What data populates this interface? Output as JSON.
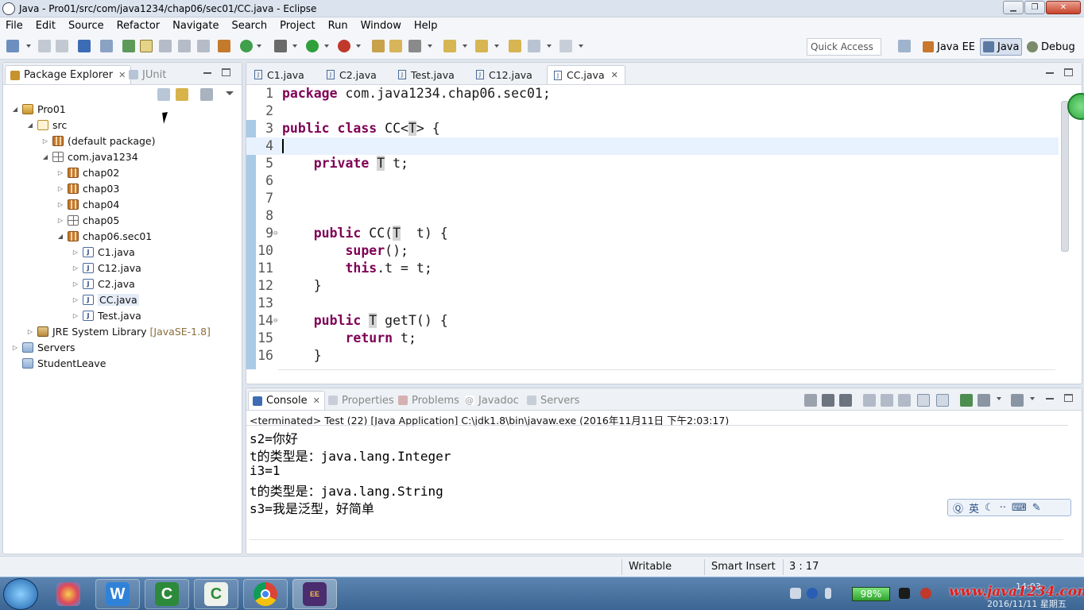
{
  "window": {
    "title": "Java - Pro01/src/com/java1234/chap06/sec01/CC.java - Eclipse"
  },
  "menu": [
    "File",
    "Edit",
    "Source",
    "Refactor",
    "Navigate",
    "Search",
    "Project",
    "Run",
    "Window",
    "Help"
  ],
  "toolbar": {
    "quick_access": "Quick Access",
    "perspectives": [
      "Java EE",
      "Java",
      "Debug"
    ]
  },
  "left_panel": {
    "tabs": [
      {
        "label": "Package Explorer",
        "active": true
      },
      {
        "label": "JUnit",
        "active": false
      }
    ],
    "tree": [
      {
        "label": "Pro01",
        "depth": 0,
        "icon": "project-icon",
        "expanded": true
      },
      {
        "label": "src",
        "depth": 1,
        "icon": "source-folder-icon",
        "expanded": true
      },
      {
        "label": "(default package)",
        "depth": 2,
        "icon": "package-icon",
        "expanded": false
      },
      {
        "label": "com.java1234",
        "depth": 2,
        "icon": "package-empty-icon",
        "expanded": true
      },
      {
        "label": "chap02",
        "depth": 3,
        "icon": "package-icon",
        "expanded": false
      },
      {
        "label": "chap03",
        "depth": 3,
        "icon": "package-icon",
        "expanded": false
      },
      {
        "label": "chap04",
        "depth": 3,
        "icon": "package-icon",
        "expanded": false
      },
      {
        "label": "chap05",
        "depth": 3,
        "icon": "package-empty-icon",
        "expanded": false
      },
      {
        "label": "chap06.sec01",
        "depth": 3,
        "icon": "package-icon",
        "expanded": true
      },
      {
        "label": "C1.java",
        "depth": 4,
        "icon": "java-file-icon",
        "expanded": false
      },
      {
        "label": "C12.java",
        "depth": 4,
        "icon": "java-file-icon",
        "expanded": false
      },
      {
        "label": "C2.java",
        "depth": 4,
        "icon": "java-file-icon",
        "expanded": false
      },
      {
        "label": "CC.java",
        "depth": 4,
        "icon": "java-file-icon",
        "expanded": false,
        "selected": true
      },
      {
        "label": "Test.java",
        "depth": 4,
        "icon": "java-file-icon",
        "expanded": false
      },
      {
        "label": "JRE System Library",
        "suffix": "[JavaSE-1.8]",
        "depth": 1,
        "icon": "library-icon",
        "expanded": false
      },
      {
        "label": "Servers",
        "depth": 0,
        "icon": "folder-icon",
        "expanded": false
      },
      {
        "label": "StudentLeave",
        "depth": 0,
        "icon": "folder-icon",
        "leaf": true
      }
    ]
  },
  "editor": {
    "tabs": [
      {
        "label": "C1.java"
      },
      {
        "label": "C2.java"
      },
      {
        "label": "Test.java"
      },
      {
        "label": "C12.java"
      },
      {
        "label": "CC.java",
        "active": true
      }
    ],
    "lines": [
      {
        "n": "1",
        "segs": [
          [
            "kw",
            "package"
          ],
          [
            "",
            "com.java1234.chap06.sec01;"
          ]
        ]
      },
      {
        "n": "2",
        "segs": []
      },
      {
        "n": "3",
        "segs": [
          [
            "kw",
            "public"
          ],
          [
            "kw",
            "class"
          ],
          [
            "",
            "CC<"
          ],
          [
            "tv",
            "T"
          ],
          [
            "",
            "> {"
          ]
        ]
      },
      {
        "n": "4",
        "segs": [],
        "current": true
      },
      {
        "n": "5",
        "segs": [
          [
            "",
            "    "
          ],
          [
            "kw",
            "private"
          ],
          [
            "tv",
            "T"
          ],
          [
            "",
            "t;"
          ]
        ]
      },
      {
        "n": "6",
        "segs": []
      },
      {
        "n": "7",
        "segs": []
      },
      {
        "n": "8",
        "segs": []
      },
      {
        "n": "9",
        "fold": true,
        "segs": [
          [
            "",
            "    "
          ],
          [
            "kw",
            "public"
          ],
          [
            "",
            "CC("
          ],
          [
            "tv",
            "T"
          ],
          [
            "",
            " t) {"
          ]
        ]
      },
      {
        "n": "10",
        "segs": [
          [
            "",
            "        "
          ],
          [
            "kw",
            "super"
          ],
          [
            "",
            "();"
          ]
        ]
      },
      {
        "n": "11",
        "segs": [
          [
            "",
            "        "
          ],
          [
            "kw",
            "this"
          ],
          [
            "",
            ".t = t;"
          ]
        ]
      },
      {
        "n": "12",
        "segs": [
          [
            "",
            "    }"
          ]
        ]
      },
      {
        "n": "13",
        "segs": []
      },
      {
        "n": "14",
        "fold": true,
        "segs": [
          [
            "",
            "    "
          ],
          [
            "kw",
            "public"
          ],
          [
            "tv",
            "T"
          ],
          [
            "",
            "getT() {"
          ]
        ]
      },
      {
        "n": "15",
        "segs": [
          [
            "",
            "        "
          ],
          [
            "kw",
            "return"
          ],
          [
            "",
            "t;"
          ]
        ]
      },
      {
        "n": "16",
        "segs": [
          [
            "",
            "    }"
          ]
        ]
      }
    ]
  },
  "console": {
    "tabs": [
      {
        "label": "Console",
        "active": true
      },
      {
        "label": "Properties"
      },
      {
        "label": "Problems"
      },
      {
        "label": "Javadoc"
      },
      {
        "label": "Servers"
      }
    ],
    "status": "<terminated> Test (22) [Java Application] C:\\jdk1.8\\bin\\javaw.exe (2016年11月11日 下午2:03:17)",
    "output": [
      "s2=你好",
      "t的类型是：java.lang.Integer",
      "i3=1",
      "t的类型是：java.lang.String",
      "s3=我是泛型，好简单"
    ],
    "ime": "英"
  },
  "statusbar": {
    "writable": "Writable",
    "insert_mode": "Smart Insert",
    "position": "3 : 17"
  },
  "taskbar": {
    "battery": "98%",
    "site": "www.java1234.com",
    "date": "2016/11/11 星期五",
    "time": "14:03"
  }
}
